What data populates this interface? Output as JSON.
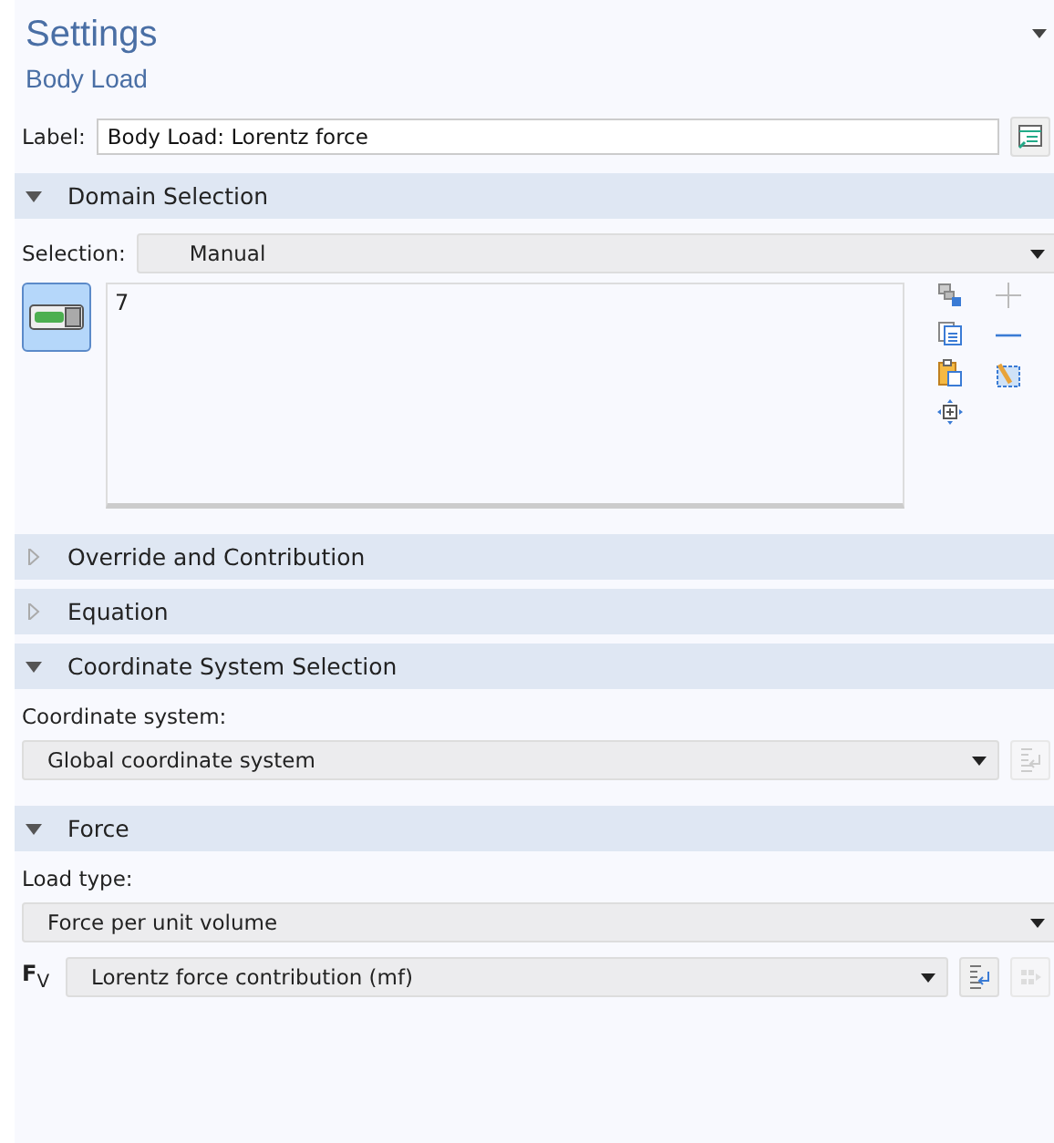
{
  "title": "Settings",
  "subtitle": "Body Load",
  "label_field": {
    "label": "Label:",
    "value": "Body Load: Lorentz force"
  },
  "sections": [
    {
      "kind": "domain",
      "title": "Domain Selection",
      "expanded": true,
      "selection_label": "Selection:",
      "selection_value": "Manual",
      "entities": [
        "7"
      ],
      "active": true
    },
    {
      "title": "Override and Contribution",
      "expanded": false
    },
    {
      "title": "Equation",
      "expanded": false
    },
    {
      "kind": "coord",
      "title": "Coordinate System Selection",
      "expanded": true,
      "field_label": "Coordinate system:",
      "value": "Global coordinate system"
    },
    {
      "kind": "force",
      "title": "Force",
      "expanded": true,
      "field_label": "Load type:",
      "value": "Force per unit volume",
      "symbol": "**F**$_{V}$",
      "contribution": "Lorentz force contribution (mf)"
    }
  ]
}
